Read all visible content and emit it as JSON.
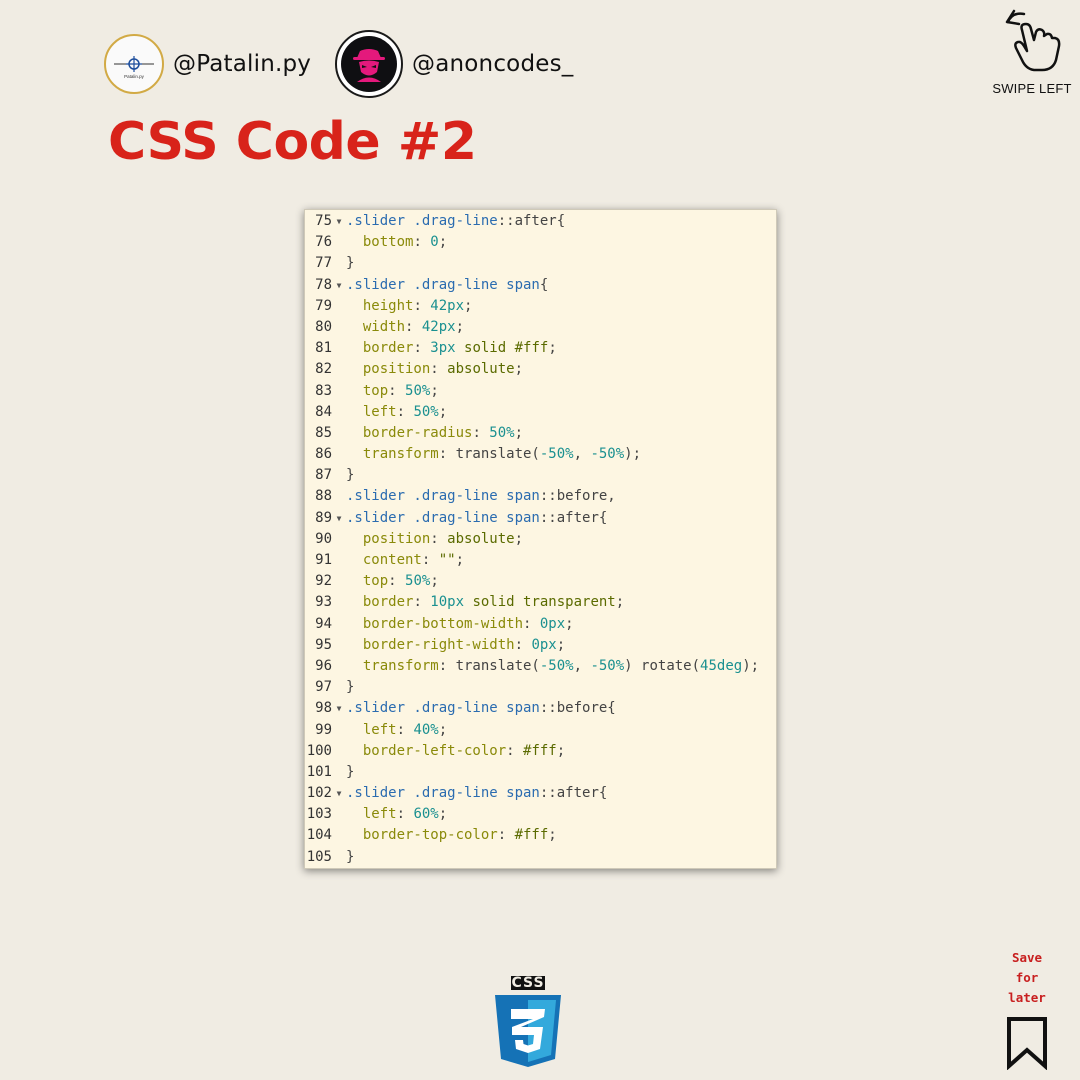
{
  "profiles": [
    {
      "handle": "@Patalin.py",
      "avatar_text": "Patalin.py"
    },
    {
      "handle": "@anoncodes_"
    }
  ],
  "title": "CSS Code #2",
  "swipe_label": "SWIPE LEFT",
  "code_lines": [
    {
      "num": "75",
      "fold": true,
      "tokens": [
        [
          ".slider .drag-line",
          "sel"
        ],
        [
          "::after{",
          "punc"
        ]
      ]
    },
    {
      "num": "76",
      "fold": false,
      "tokens": [
        [
          "  ",
          "punc"
        ],
        [
          "bottom",
          "prop"
        ],
        [
          ": ",
          "punc"
        ],
        [
          "0",
          "num"
        ],
        [
          ";",
          "punc"
        ]
      ]
    },
    {
      "num": "77",
      "fold": false,
      "tokens": [
        [
          "}",
          "punc"
        ]
      ]
    },
    {
      "num": "78",
      "fold": true,
      "tokens": [
        [
          ".slider .drag-line span",
          "sel"
        ],
        [
          "{",
          "punc"
        ]
      ]
    },
    {
      "num": "79",
      "fold": false,
      "tokens": [
        [
          "  ",
          "punc"
        ],
        [
          "height",
          "prop"
        ],
        [
          ": ",
          "punc"
        ],
        [
          "42px",
          "num"
        ],
        [
          ";",
          "punc"
        ]
      ]
    },
    {
      "num": "80",
      "fold": false,
      "tokens": [
        [
          "  ",
          "punc"
        ],
        [
          "width",
          "prop"
        ],
        [
          ": ",
          "punc"
        ],
        [
          "42px",
          "num"
        ],
        [
          ";",
          "punc"
        ]
      ]
    },
    {
      "num": "81",
      "fold": false,
      "tokens": [
        [
          "  ",
          "punc"
        ],
        [
          "border",
          "prop"
        ],
        [
          ": ",
          "punc"
        ],
        [
          "3px",
          "num"
        ],
        [
          " solid #fff",
          "val"
        ],
        [
          ";",
          "punc"
        ]
      ]
    },
    {
      "num": "82",
      "fold": false,
      "tokens": [
        [
          "  ",
          "punc"
        ],
        [
          "position",
          "prop"
        ],
        [
          ": ",
          "punc"
        ],
        [
          "absolute",
          "val"
        ],
        [
          ";",
          "punc"
        ]
      ]
    },
    {
      "num": "83",
      "fold": false,
      "tokens": [
        [
          "  ",
          "punc"
        ],
        [
          "top",
          "prop"
        ],
        [
          ": ",
          "punc"
        ],
        [
          "50%",
          "num"
        ],
        [
          ";",
          "punc"
        ]
      ]
    },
    {
      "num": "84",
      "fold": false,
      "tokens": [
        [
          "  ",
          "punc"
        ],
        [
          "left",
          "prop"
        ],
        [
          ": ",
          "punc"
        ],
        [
          "50%",
          "num"
        ],
        [
          ";",
          "punc"
        ]
      ]
    },
    {
      "num": "85",
      "fold": false,
      "tokens": [
        [
          "  ",
          "punc"
        ],
        [
          "border-radius",
          "prop"
        ],
        [
          ": ",
          "punc"
        ],
        [
          "50%",
          "num"
        ],
        [
          ";",
          "punc"
        ]
      ]
    },
    {
      "num": "86",
      "fold": false,
      "tokens": [
        [
          "  ",
          "punc"
        ],
        [
          "transform",
          "prop"
        ],
        [
          ": translate(",
          "punc"
        ],
        [
          "-50%",
          "num"
        ],
        [
          ", ",
          "punc"
        ],
        [
          "-50%",
          "num"
        ],
        [
          ");",
          "punc"
        ]
      ]
    },
    {
      "num": "87",
      "fold": false,
      "tokens": [
        [
          "}",
          "punc"
        ]
      ]
    },
    {
      "num": "88",
      "fold": false,
      "tokens": [
        [
          ".slider .drag-line span",
          "sel"
        ],
        [
          "::before,",
          "punc"
        ]
      ]
    },
    {
      "num": "89",
      "fold": true,
      "tokens": [
        [
          ".slider .drag-line span",
          "sel"
        ],
        [
          "::after{",
          "punc"
        ]
      ]
    },
    {
      "num": "90",
      "fold": false,
      "tokens": [
        [
          "  ",
          "punc"
        ],
        [
          "position",
          "prop"
        ],
        [
          ": ",
          "punc"
        ],
        [
          "absolute",
          "val"
        ],
        [
          ";",
          "punc"
        ]
      ]
    },
    {
      "num": "91",
      "fold": false,
      "tokens": [
        [
          "  ",
          "punc"
        ],
        [
          "content",
          "prop"
        ],
        [
          ": ",
          "punc"
        ],
        [
          "\"\"",
          "val"
        ],
        [
          ";",
          "punc"
        ]
      ]
    },
    {
      "num": "92",
      "fold": false,
      "tokens": [
        [
          "  ",
          "punc"
        ],
        [
          "top",
          "prop"
        ],
        [
          ": ",
          "punc"
        ],
        [
          "50%",
          "num"
        ],
        [
          ";",
          "punc"
        ]
      ]
    },
    {
      "num": "93",
      "fold": false,
      "tokens": [
        [
          "  ",
          "punc"
        ],
        [
          "border",
          "prop"
        ],
        [
          ": ",
          "punc"
        ],
        [
          "10px",
          "num"
        ],
        [
          " solid transparent",
          "val"
        ],
        [
          ";",
          "punc"
        ]
      ]
    },
    {
      "num": "94",
      "fold": false,
      "tokens": [
        [
          "  ",
          "punc"
        ],
        [
          "border-bottom-width",
          "prop"
        ],
        [
          ": ",
          "punc"
        ],
        [
          "0px",
          "num"
        ],
        [
          ";",
          "punc"
        ]
      ]
    },
    {
      "num": "95",
      "fold": false,
      "tokens": [
        [
          "  ",
          "punc"
        ],
        [
          "border-right-width",
          "prop"
        ],
        [
          ": ",
          "punc"
        ],
        [
          "0px",
          "num"
        ],
        [
          ";",
          "punc"
        ]
      ]
    },
    {
      "num": "96",
      "fold": false,
      "tokens": [
        [
          "  ",
          "punc"
        ],
        [
          "transform",
          "prop"
        ],
        [
          ": translate(",
          "punc"
        ],
        [
          "-50%",
          "num"
        ],
        [
          ", ",
          "punc"
        ],
        [
          "-50%",
          "num"
        ],
        [
          ") rotate(",
          "punc"
        ],
        [
          "45deg",
          "num"
        ],
        [
          ");",
          "punc"
        ]
      ]
    },
    {
      "num": "97",
      "fold": false,
      "tokens": [
        [
          "}",
          "punc"
        ]
      ]
    },
    {
      "num": "98",
      "fold": true,
      "tokens": [
        [
          ".slider .drag-line span",
          "sel"
        ],
        [
          "::before{",
          "punc"
        ]
      ]
    },
    {
      "num": "99",
      "fold": false,
      "tokens": [
        [
          "  ",
          "punc"
        ],
        [
          "left",
          "prop"
        ],
        [
          ": ",
          "punc"
        ],
        [
          "40%",
          "num"
        ],
        [
          ";",
          "punc"
        ]
      ]
    },
    {
      "num": "100",
      "fold": false,
      "tokens": [
        [
          "  ",
          "punc"
        ],
        [
          "border-left-color",
          "prop"
        ],
        [
          ": ",
          "punc"
        ],
        [
          "#fff",
          "val"
        ],
        [
          ";",
          "punc"
        ]
      ]
    },
    {
      "num": "101",
      "fold": false,
      "tokens": [
        [
          "}",
          "punc"
        ]
      ]
    },
    {
      "num": "102",
      "fold": true,
      "tokens": [
        [
          ".slider .drag-line span",
          "sel"
        ],
        [
          "::after{",
          "punc"
        ]
      ]
    },
    {
      "num": "103",
      "fold": false,
      "tokens": [
        [
          "  ",
          "punc"
        ],
        [
          "left",
          "prop"
        ],
        [
          ": ",
          "punc"
        ],
        [
          "60%",
          "num"
        ],
        [
          ";",
          "punc"
        ]
      ]
    },
    {
      "num": "104",
      "fold": false,
      "tokens": [
        [
          "  ",
          "punc"
        ],
        [
          "border-top-color",
          "prop"
        ],
        [
          ": ",
          "punc"
        ],
        [
          "#fff",
          "val"
        ],
        [
          ";",
          "punc"
        ]
      ]
    },
    {
      "num": "105",
      "fold": false,
      "tokens": [
        [
          "}",
          "punc"
        ]
      ]
    }
  ],
  "css_logo_text": "CSS",
  "save_lines": [
    "Save",
    "for",
    "later"
  ],
  "icons": {
    "swipe": "swipe-left-hand-icon",
    "bookmark": "bookmark-icon",
    "css": "css3-logo-icon",
    "avatar2": "hacker-icon"
  },
  "colors": {
    "background": "#f0ece3",
    "title": "#d8231a",
    "code_bg": "#fdf6e2",
    "save_text": "#c81f1f",
    "css_blue": "#1572b6"
  }
}
